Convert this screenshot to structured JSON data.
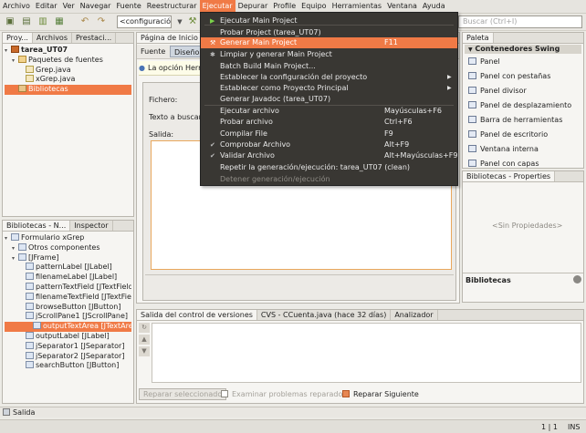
{
  "menubar": [
    "Archivo",
    "Editar",
    "Ver",
    "Navegar",
    "Fuente",
    "Reestructurar",
    "Ejecutar",
    "Depurar",
    "Profile",
    "Equipo",
    "Herramientas",
    "Ventana",
    "Ayuda"
  ],
  "toolbar": {
    "config_combo": "<configuració...",
    "search_placeholder": "Buscar (Ctrl+I)"
  },
  "run_menu": {
    "items": [
      {
        "label": "Ejecutar Main Project",
        "shortcut": "",
        "icon": "play-icon"
      },
      {
        "label": "Probar Project (tarea_UT07)",
        "shortcut": ""
      },
      {
        "label": "Generar Main Project",
        "shortcut": "F11",
        "icon": "hammer-icon",
        "highlighted": true
      },
      {
        "label": "Limpiar y generar Main Project",
        "shortcut": "",
        "icon": "broom-icon"
      },
      {
        "label": "Batch Build Main Project...",
        "shortcut": ""
      },
      {
        "label": "Establecer la configuración del proyecto",
        "shortcut": "",
        "submenu": true
      },
      {
        "label": "Establecer como Proyecto Principal",
        "shortcut": "",
        "submenu": true
      },
      {
        "label": "Generar Javadoc (tarea_UT07)",
        "shortcut": ""
      },
      {
        "label": "Ejecutar archivo",
        "shortcut": "Mayúsculas+F6"
      },
      {
        "label": "Probar archivo",
        "shortcut": "Ctrl+F6"
      },
      {
        "label": "Compilar File",
        "shortcut": "F9"
      },
      {
        "label": "Comprobar Archivo",
        "shortcut": "Alt+F9",
        "icon": "check-icon"
      },
      {
        "label": "Validar Archivo",
        "shortcut": "Alt+Mayúsculas+F9",
        "icon": "check-icon"
      },
      {
        "label": "Repetir la generación/ejecución: tarea_UT07 (clean)",
        "shortcut": ""
      },
      {
        "label": "Detener generación/ejecución",
        "shortcut": "",
        "disabled": true
      }
    ]
  },
  "projects_panel": {
    "tabs": [
      "Proy...",
      "Archivos",
      "Prestaci..."
    ],
    "tree": [
      {
        "label": "tarea_UT07",
        "level": 0,
        "icon": "proj",
        "bold": true
      },
      {
        "label": "Paquetes de fuentes",
        "level": 1,
        "icon": "pkg"
      },
      {
        "label": "Grep.java",
        "level": 2,
        "icon": "java"
      },
      {
        "label": "xGrep.java",
        "level": 2,
        "icon": "java"
      },
      {
        "label": "Bibliotecas",
        "level": 1,
        "icon": "lib",
        "selected": true
      }
    ]
  },
  "editor": {
    "tab": "Página de Inicio",
    "subtabs": [
      "Fuente",
      "Diseño"
    ],
    "info": "La opción Herra",
    "labels": {
      "fichero": "Fichero:",
      "texto": "Texto a buscar:",
      "salida": "Salida:"
    }
  },
  "inspector": {
    "tabs": [
      "Bibliotecas - N...",
      "Inspector"
    ],
    "tree": [
      {
        "label": "Formulario xGrep",
        "level": 0
      },
      {
        "label": "Otros componentes",
        "level": 1
      },
      {
        "label": "[JFrame]",
        "level": 1
      },
      {
        "label": "patternLabel [JLabel]",
        "level": 2
      },
      {
        "label": "filenameLabel [JLabel]",
        "level": 2
      },
      {
        "label": "patternTextField [JTextField]",
        "level": 2
      },
      {
        "label": "filenameTextField [JTextField]",
        "level": 2
      },
      {
        "label": "browseButton [JButton]",
        "level": 2
      },
      {
        "label": "jScrollPane1 [JScrollPane]",
        "level": 2
      },
      {
        "label": "outputTextArea [JTextArea]",
        "level": 3,
        "selected": true
      },
      {
        "label": "outputLabel [JLabel]",
        "level": 2
      },
      {
        "label": "jSeparator1 [JSeparator]",
        "level": 2
      },
      {
        "label": "jSeparator2 [JSeparator]",
        "level": 2
      },
      {
        "label": "searchButton [JButton]",
        "level": 2
      }
    ]
  },
  "palette": {
    "tab": "Paleta",
    "group": "Contenedores Swing",
    "items": [
      "Panel",
      "Panel con pestañas",
      "Panel divisor",
      "Panel de desplazamiento",
      "Barra de herramientas",
      "Panel de escritorio",
      "Ventana interna",
      "Panel con capas"
    ]
  },
  "properties": {
    "tab": "Bibliotecas - Properties",
    "empty": "<Sin Propiedades>",
    "footer": "Bibliotecas"
  },
  "bottom": {
    "tabs": [
      "Salida del control de versiones",
      "CVS - CCuenta.java (hace 32 días)",
      "Analizador"
    ],
    "repair_button": "Reparar seleccionado",
    "examine_label": "Examinar problemas reparados",
    "next_label": "Reparar Siguiente"
  },
  "status": {
    "output": "Salida",
    "position": "1 | 1",
    "mode": "INS"
  },
  "colors": {
    "accent": "#f07a46",
    "menu_bg": "#393733"
  }
}
